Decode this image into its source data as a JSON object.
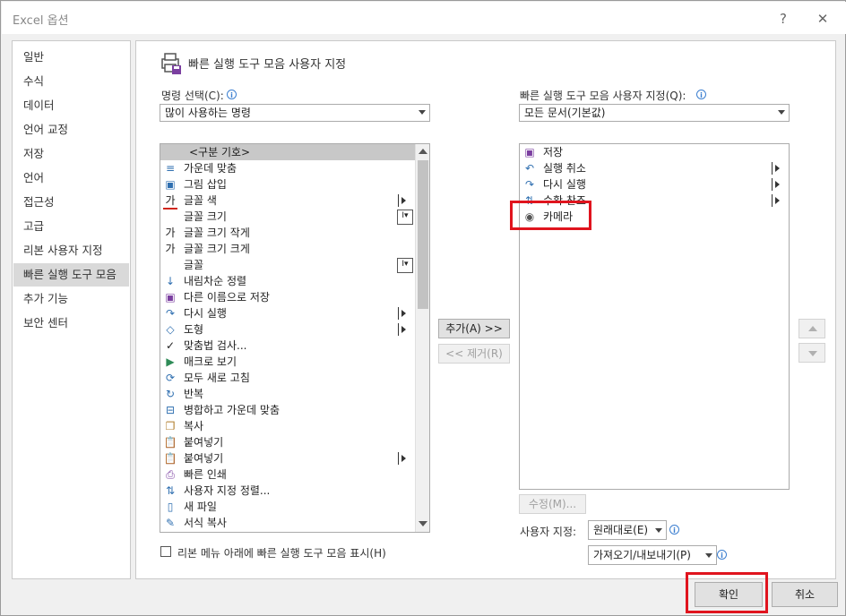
{
  "window": {
    "title": "Excel 옵션",
    "help": "?",
    "close": "✕"
  },
  "nav": [
    {
      "label": "일반"
    },
    {
      "label": "수식"
    },
    {
      "label": "데이터"
    },
    {
      "label": "언어 교정"
    },
    {
      "label": "저장"
    },
    {
      "label": "언어"
    },
    {
      "label": "접근성"
    },
    {
      "label": "고급"
    },
    {
      "label": "리본 사용자 지정"
    },
    {
      "label": "빠른 실행 도구 모음",
      "selected": true
    },
    {
      "label": "추가 기능"
    },
    {
      "label": "보안 센터"
    }
  ],
  "header": {
    "title": "빠른 실행 도구 모음 사용자 지정"
  },
  "left": {
    "label": "명령 선택(C):",
    "combo_value": "많이 사용하는 명령",
    "commands": [
      {
        "label": "<구분 기호>",
        "icon": "separator",
        "selected": true
      },
      {
        "label": "가운데 맞춤",
        "icon": "align-center-icon"
      },
      {
        "label": "그림 삽입",
        "icon": "picture-icon"
      },
      {
        "label": "글꼴 색",
        "icon": "font-color-icon",
        "flyout": true
      },
      {
        "label": "글꼴 크기",
        "icon": "font-size-icon",
        "ibeam": true
      },
      {
        "label": "글꼴 크기 작게",
        "icon": "font-decrease-icon"
      },
      {
        "label": "글꼴 크기 크게",
        "icon": "font-increase-icon"
      },
      {
        "label": "글꼴",
        "icon": "font-icon",
        "ibeam": true
      },
      {
        "label": "내림차순 정렬",
        "icon": "sort-desc-icon"
      },
      {
        "label": "다른 이름으로 저장",
        "icon": "save-as-icon"
      },
      {
        "label": "다시 실행",
        "icon": "redo-icon",
        "flyout": true
      },
      {
        "label": "도형",
        "icon": "shapes-icon",
        "flyout": true
      },
      {
        "label": "맞춤법 검사...",
        "icon": "spelling-icon"
      },
      {
        "label": "매크로 보기",
        "icon": "macro-icon"
      },
      {
        "label": "모두 새로 고침",
        "icon": "refresh-all-icon"
      },
      {
        "label": "반복",
        "icon": "repeat-icon"
      },
      {
        "label": "병합하고 가운데 맞춤",
        "icon": "merge-center-icon"
      },
      {
        "label": "복사",
        "icon": "copy-icon"
      },
      {
        "label": "붙여넣기",
        "icon": "paste-icon"
      },
      {
        "label": "붙여넣기",
        "icon": "paste-icon",
        "flyout": true
      },
      {
        "label": "빠른 인쇄",
        "icon": "quick-print-icon"
      },
      {
        "label": "사용자 지정 정렬...",
        "icon": "custom-sort-icon"
      },
      {
        "label": "새 파일",
        "icon": "new-file-icon"
      },
      {
        "label": "서식 복사",
        "icon": "format-painter-icon"
      }
    ],
    "checkbox_label": "리본 메뉴 아래에 빠른 실행 도구 모음 표시(H)"
  },
  "middle": {
    "add_label": "추가(A) >>",
    "remove_label": "<< 제거(R)"
  },
  "right": {
    "label": "빠른 실행 도구 모음 사용자 지정(Q):",
    "combo_value": "모든 문서(기본값)",
    "items": [
      {
        "label": "저장",
        "icon": "save-icon"
      },
      {
        "label": "실행 취소",
        "icon": "undo-icon",
        "flyout": true
      },
      {
        "label": "다시 실행",
        "icon": "redo-icon",
        "flyout": true
      },
      {
        "label": "수확 찬조",
        "icon": "sort-icon",
        "flyout": true
      },
      {
        "label": "카메라",
        "icon": "camera-icon"
      }
    ],
    "modify_label": "수정(M)...",
    "customize_label": "사용자 지정:",
    "reset_value": "원래대로(E)",
    "import_export_value": "가져오기/내보내기(P)"
  },
  "footer": {
    "ok_label": "확인",
    "cancel_label": "취소"
  },
  "colors": {
    "highlight_box": "#e0141e",
    "selected_nav": "#d9d9d9",
    "accent": "#2f6fb0"
  }
}
